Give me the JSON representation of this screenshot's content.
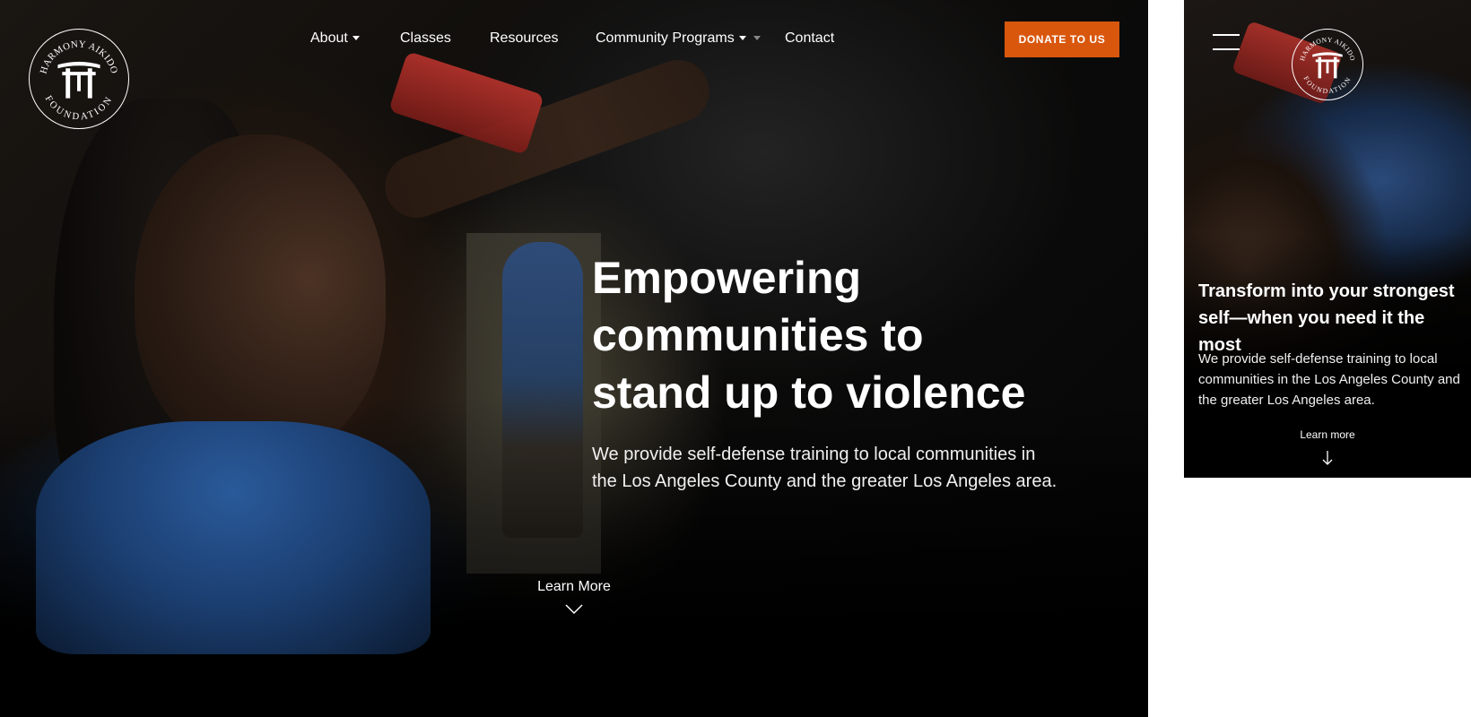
{
  "brand": {
    "name_top": "HARMONY AIKIDO",
    "name_bottom": "FOUNDATION"
  },
  "nav": {
    "items": [
      {
        "label": "About",
        "has_dropdown": true
      },
      {
        "label": "Classes",
        "has_dropdown": false
      },
      {
        "label": "Resources",
        "has_dropdown": false
      },
      {
        "label": "Community Programs",
        "has_dropdown": true
      },
      {
        "label": "Contact",
        "has_dropdown": false
      }
    ]
  },
  "donate_button": {
    "label": "DONATE TO US",
    "color": "#d9570d"
  },
  "hero": {
    "headline_lines": [
      "Empowering",
      "communities to",
      "stand up to violence"
    ],
    "subhead": "We provide self-defense training to local communities in the Los Angeles County and the greater Los Angeles area.",
    "learn_more": "Learn More",
    "learn_more_icon": "chevron-down-icon"
  },
  "mobile": {
    "menu_icon": "hamburger-icon",
    "headline": "Transform into your strongest self—when you need it the most",
    "subhead": "We provide self-defense training to local communities in the Los Angeles County and the greater Los Angeles area.",
    "learn_more": "Learn more",
    "learn_more_icon": "arrow-down-icon"
  }
}
